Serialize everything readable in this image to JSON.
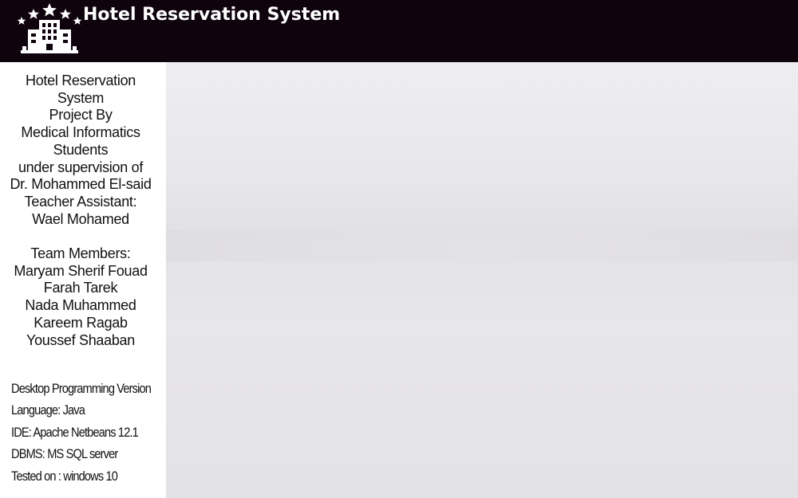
{
  "header": {
    "title": "Hotel Reservation System",
    "logo_icon": "hotel-building-stars-icon",
    "background": "#0f030e",
    "text_color": "#ffffff"
  },
  "sidebar": {
    "info_lines": [
      "Hotel Reservation",
      "System",
      "Project By",
      "Medical Informatics",
      "Students",
      "under supervision of",
      "Dr. Mohammed El-said",
      "Teacher Assistant:",
      "Wael Mohamed"
    ],
    "team_heading": "Team Members:",
    "team_members": [
      "Maryam Sherif Fouad",
      "Farah Tarek",
      "Nada Muhammed",
      "Kareem Ragab",
      "Youssef Shaaban"
    ],
    "tech_lines": [
      "Desktop Programming Version",
      "Language: Java",
      "IDE: Apache Netbeans 12.1",
      "DBMS: MS SQL server",
      "Tested on : windows 10"
    ]
  },
  "main": {
    "background": "#e7e6e9"
  }
}
